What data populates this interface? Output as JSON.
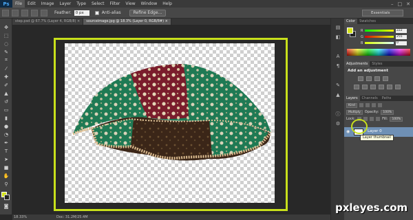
{
  "app": {
    "logo": "Ps",
    "menus": [
      "File",
      "Edit",
      "Image",
      "Layer",
      "Type",
      "Select",
      "Filter",
      "View",
      "Window",
      "Help"
    ],
    "active_menu": "File",
    "window_controls": [
      "–",
      "□",
      "✕"
    ]
  },
  "options_bar": {
    "feather_label": "Feather:",
    "feather_value": "0 px",
    "antialias_label": "Anti-alias",
    "refine_edge_label": "Refine Edge...",
    "workspace": "Essentials"
  },
  "tabs": [
    {
      "label": "step.psd @ 67.7% (Layer 4, RGB/8) ×",
      "active": false
    },
    {
      "label": "sourceimage.jpg @ 18.3% (Layer 0, RGB/8#) ×",
      "active": true
    }
  ],
  "statusbar": {
    "zoom": "18.33%",
    "doc_size": "Doc: 31.2M/25.4M"
  },
  "color_panel": {
    "tabs": [
      "Color",
      "Swatches"
    ],
    "fg_color": "#d4e21a",
    "sliders": [
      {
        "letter": "R",
        "value": "222"
      },
      {
        "letter": "G",
        "value": "255"
      },
      {
        "letter": "B",
        "value": "0"
      }
    ]
  },
  "adjustments_panel": {
    "tabs": [
      "Adjustments",
      "Styles"
    ],
    "heading": "Add an adjustment"
  },
  "layers_panel": {
    "tabs": [
      "Layers",
      "Channels",
      "Paths"
    ],
    "kind_filter": "Kind",
    "blend_mode": "Multiply",
    "opacity_label": "Opacity:",
    "opacity_value": "100%",
    "lock_label": "Lock:",
    "fill_label": "Fill:",
    "fill_value": "100%",
    "layer_name": "Layer 0",
    "tooltip": "Layer thumbnail"
  },
  "watermark": "pxleyes.com",
  "accent_color": "#c8e01b"
}
